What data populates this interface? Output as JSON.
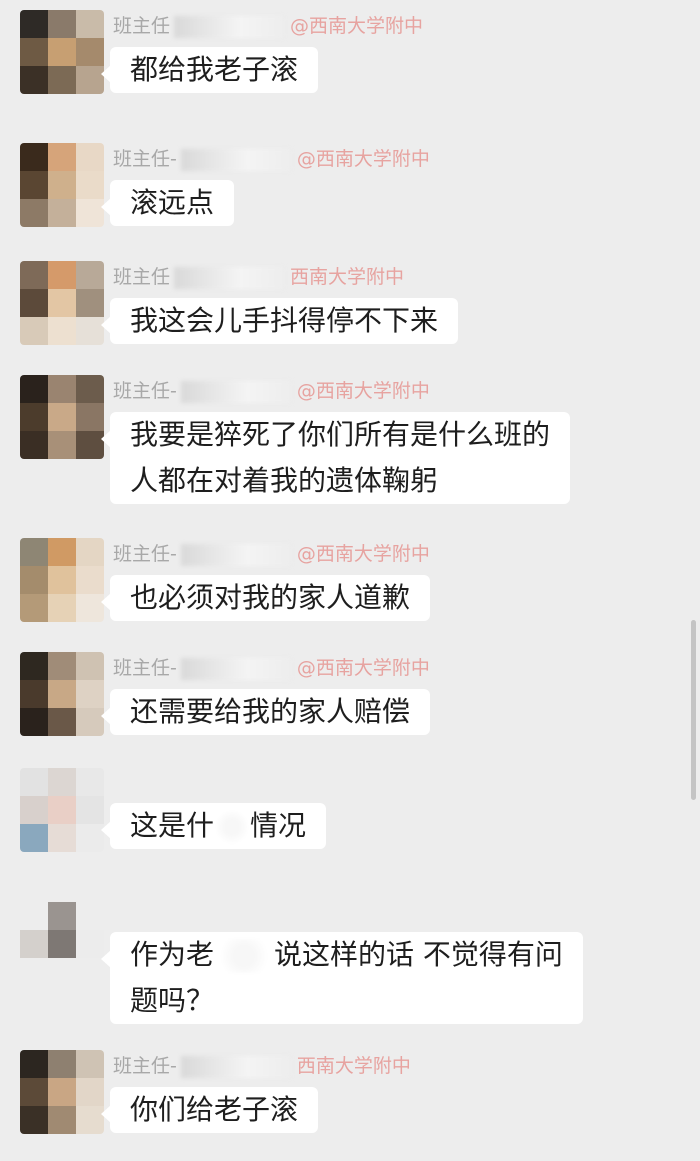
{
  "chat": {
    "messages": [
      {
        "sender": "班主任",
        "school": "@西南大学附中",
        "lines": [
          "都给我老子滚"
        ]
      },
      {
        "sender": "班主任-",
        "school": "@西南大学附中",
        "lines": [
          "滚远点"
        ]
      },
      {
        "sender": "班主任",
        "school": "西南大学附中",
        "lines": [
          "我这会儿手抖得停不下来"
        ]
      },
      {
        "sender": "班主任-",
        "school": "@西南大学附中",
        "lines": [
          "我要是猝死了你们所有是什么班的",
          "人都在对着我的遗体鞠躬"
        ]
      },
      {
        "sender": "班主任-",
        "school": "@西南大学附中",
        "lines": [
          "也必须对我的家人道歉"
        ]
      },
      {
        "sender": "班主任-",
        "school": "@西南大学附中",
        "lines": [
          "还需要给我的家人赔偿"
        ]
      },
      {
        "sender": "",
        "school": "",
        "lines_a": [
          "这是什",
          "情况"
        ]
      },
      {
        "sender": "",
        "school": "",
        "lines_b": [
          "作为老",
          "说这样的话 不觉得有问",
          "题吗？"
        ]
      },
      {
        "sender": "班主任-",
        "school": "西南大学附中",
        "lines": [
          "你们给老子滚"
        ]
      }
    ]
  },
  "colors": {
    "background": "#ededed",
    "bubble": "#ffffff",
    "sender_text": "#a8a8a8",
    "school_text": "#e7a3a0"
  }
}
